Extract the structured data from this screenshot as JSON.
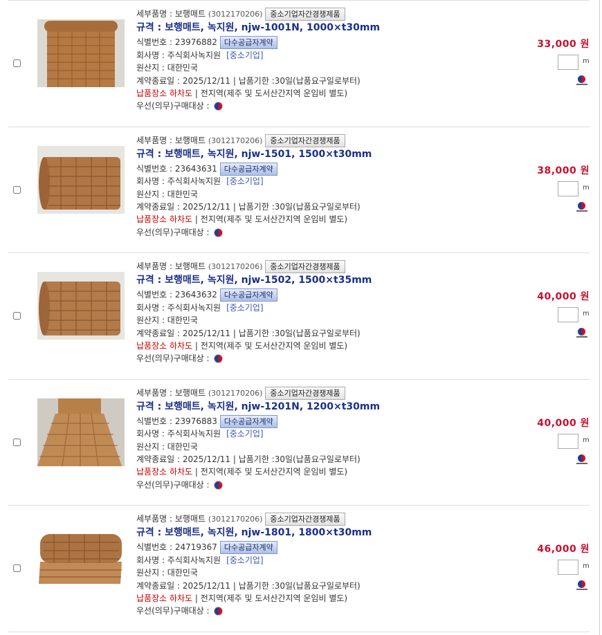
{
  "labels": {
    "detail_prefix": "세부품명 : ",
    "spec_prefix": "규격 : ",
    "id_prefix": "식별번호 : ",
    "company_prefix": "회사명 : ",
    "origin_prefix": "원산지 : ",
    "contract_prefix": "계약종료일 : ",
    "delivery_sep": " | 납품기한 :",
    "delivery_place_label": "납품장소 하차도",
    "delivery_area": " | 전지역(제주 및 도서산간지역 운임비 별도)",
    "priority_label": "우선(의무)구매대상 : ",
    "sme_competition_badge": "중소기업자간경쟁제품",
    "multi_supplier_badge": "다수공급자계약",
    "unit": "m"
  },
  "products": [
    {
      "detail_name": "보행매트",
      "detail_code": "(3012170206)",
      "spec": "보행매트, 녹지원, njw-1001N, 1000×t30mm",
      "id_number": "23976882",
      "company": "주식회사녹지원",
      "company_tag": "[중소기업]",
      "origin": "대한민국",
      "contract_end": "2025/12/11",
      "delivery_term": "30일(납품요구일로부터)",
      "price": "33,000 원",
      "qty": "",
      "image": "coir-mat-roll-standing-icon"
    },
    {
      "detail_name": "보행매트",
      "detail_code": "(3012170206)",
      "spec": "보행매트, 녹지원, njw-1501, 1500×t30mm",
      "id_number": "23643631",
      "company": "주식회사녹지원",
      "company_tag": "[중소기업]",
      "origin": "대한민국",
      "contract_end": "2025/12/11",
      "delivery_term": "30일(납품요구일로부터)",
      "price": "38,000 원",
      "qty": "",
      "image": "coir-mat-roll-icon"
    },
    {
      "detail_name": "보행매트",
      "detail_code": "(3012170206)",
      "spec": "보행매트, 녹지원, njw-1502, 1500×t35mm",
      "id_number": "23643632",
      "company": "주식회사녹지원",
      "company_tag": "[중소기업]",
      "origin": "대한민국",
      "contract_end": "2025/12/11",
      "delivery_term": "30일(납품요구일로부터)",
      "price": "40,000 원",
      "qty": "",
      "image": "coir-mat-roll-icon"
    },
    {
      "detail_name": "보행매트",
      "detail_code": "(3012170206)",
      "spec": "보행매트, 녹지원, njw-1201N, 1200×t30mm",
      "id_number": "23976883",
      "company": "주식회사녹지원",
      "company_tag": "[중소기업]",
      "origin": "대한민국",
      "contract_end": "2025/12/11",
      "delivery_term": "30일(납품요구일로부터)",
      "price": "40,000 원",
      "qty": "",
      "image": "coir-mat-unrolled-icon"
    },
    {
      "detail_name": "보행매트",
      "detail_code": "(3012170206)",
      "spec": "보행매트, 녹지원, njw-1801, 1800×t30mm",
      "id_number": "24719367",
      "company": "주식회사녹지원",
      "company_tag": "[중소기업]",
      "origin": "대한민국",
      "contract_end": "2025/12/11",
      "delivery_term": "30일(납품요구일로부터)",
      "price": "46,000 원",
      "qty": "",
      "image": "coir-mat-roll-flat-icon"
    }
  ],
  "colors": {
    "title": "#1b2f8a",
    "price": "#c8102e",
    "delivery_place": "#cc0000",
    "company_tag": "#3b58b8"
  }
}
